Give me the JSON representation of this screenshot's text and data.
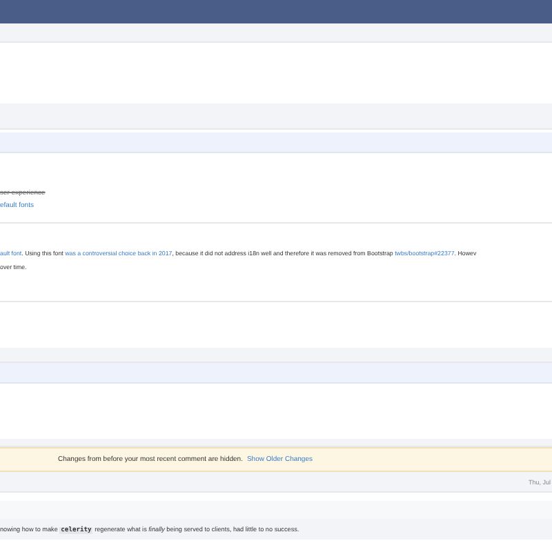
{
  "change_list": [
    {
      "text": "ser experience",
      "struck": true
    },
    {
      "text": "efault fonts",
      "struck": false
    }
  ],
  "comment": {
    "parts": [
      {
        "text": "ault font",
        "link": true
      },
      {
        "text": ". Using this font ",
        "link": false
      },
      {
        "text": "was a controversial choice back in 2017",
        "link": true
      },
      {
        "text": ", because it did not address i18n well and therefore it was removed from Bootstrap ",
        "link": false
      },
      {
        "text": "twbs/bootstrap#22377",
        "link": true
      },
      {
        "text": ". Howev",
        "link": false
      }
    ],
    "continuation": "over time."
  },
  "notice": {
    "text": "Changes from before your most recent comment are hidden.",
    "link": "Show Older Changes"
  },
  "timestamp": "Thu, Jul",
  "summary_parts": [
    {
      "text": "nowing how to make ",
      "kind": "plain"
    },
    {
      "text": "celerity",
      "kind": "code"
    },
    {
      "text": " regenerate what is ",
      "kind": "plain"
    },
    {
      "text": "finally",
      "kind": "italic"
    },
    {
      "text": " being served to clients, had little to no success.",
      "kind": "plain"
    }
  ]
}
